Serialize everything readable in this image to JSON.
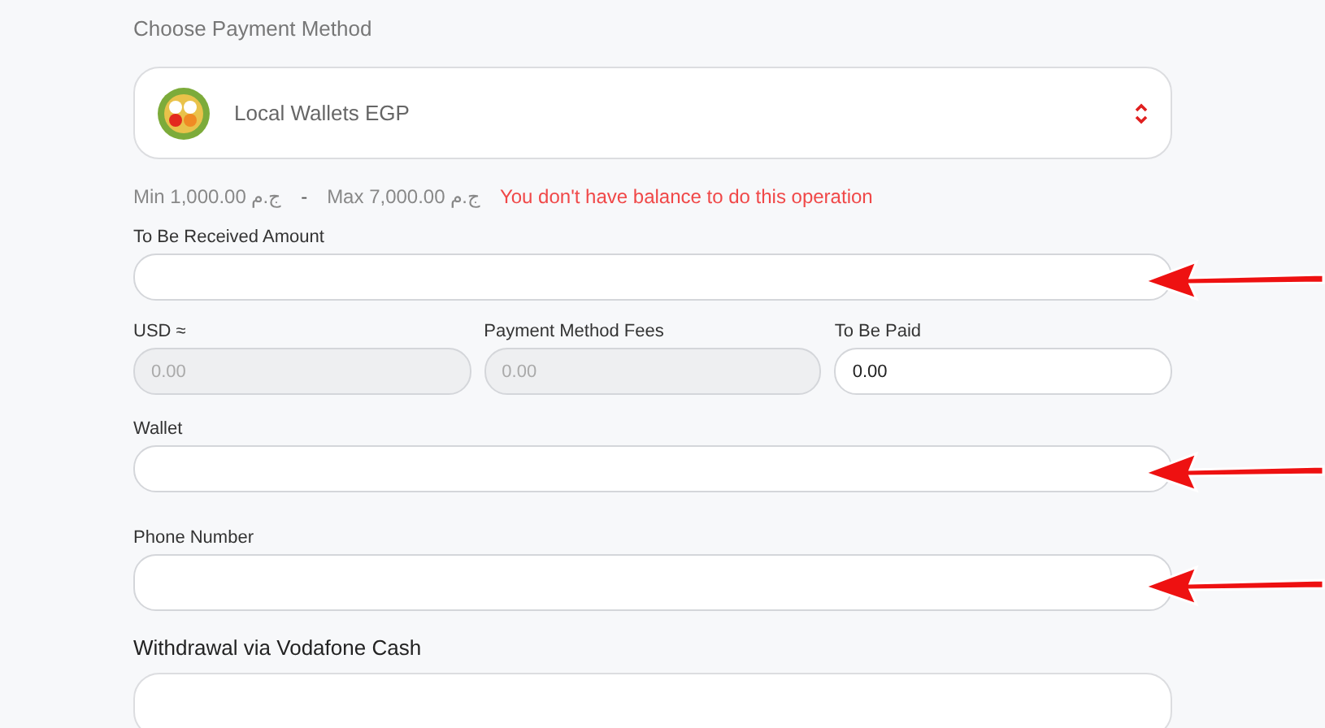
{
  "section_title": "Choose Payment Method",
  "payment_method": {
    "label": "Local Wallets EGP"
  },
  "limits": {
    "min": "Min 1,000.00 ج.م",
    "separator": "-",
    "max": "Max 7,000.00 ج.م",
    "error": "You don't have balance to do this operation"
  },
  "received_amount": {
    "label": "To Be Received Amount",
    "disabled": false,
    "marked": true
  },
  "amounts": [
    {
      "label": "USD ≈",
      "value": "0.00",
      "disabled": true
    },
    {
      "label": "Payment Method Fees",
      "value": "0.00",
      "disabled": true
    },
    {
      "label": "To Be Paid",
      "value": "0.00",
      "disabled": false
    }
  ],
  "wallet": {
    "label": "Wallet",
    "disabled": false,
    "marked": true
  },
  "phone": {
    "label": "Phone Number",
    "disabled": false,
    "marked": true
  },
  "withdrawal_title": "Withdrawal via Vodafone Cash"
}
